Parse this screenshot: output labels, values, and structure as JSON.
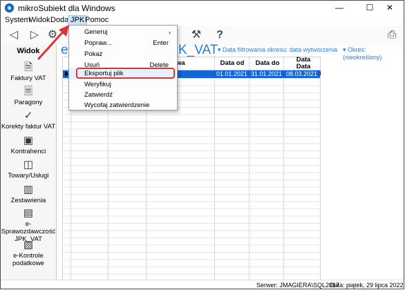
{
  "window": {
    "title": "mikroSubiekt dla Windows",
    "minimize_glyph": "—",
    "maximize_glyph": "☐",
    "close_glyph": "✕"
  },
  "menubar": {
    "items": [
      "System",
      "Widok",
      "Dodaj",
      "JPK",
      "Pomoc"
    ]
  },
  "toolbar": {
    "icons": [
      "back-arrow-icon",
      "forward-arrow-icon",
      "settings-icon",
      "tools-icon",
      "help-icon",
      "printer-icon"
    ]
  },
  "sidebar": {
    "title": "Widok",
    "items": [
      {
        "label": "Faktury VAT",
        "icon": "invoice-icon"
      },
      {
        "label": "Paragony",
        "icon": "receipt-icon"
      },
      {
        "label": "Korekty faktur VAT",
        "icon": "correction-icon"
      },
      {
        "label": "Kontrahenci",
        "icon": "contractors-icon"
      },
      {
        "label": "Towary/Usługi",
        "icon": "goods-icon"
      },
      {
        "label": "Zestawienia",
        "icon": "reports-icon"
      },
      {
        "label": "e-Sprawozdawczość JPK_VAT",
        "icon": "jpk-report-icon"
      },
      {
        "label": "e-Kontrole podatkowe",
        "icon": "tax-control-icon"
      }
    ]
  },
  "content": {
    "heading_prefix": "e-",
    "heading_suffix": "K_VAT",
    "date_filter": "Data filtrowania okresu: data wytworzenia",
    "period_filter": "Okres: (nieokreślony)",
    "columns": {
      "name_fragment": "wa",
      "date_from": "Data od",
      "date_to": "Data do",
      "created": "Data wytworzeni"
    },
    "selected_row": {
      "date_from": "01.01.2021",
      "date_to": "31.01.2021",
      "created": "08.03.2021 13"
    }
  },
  "dropdown": {
    "items": [
      {
        "label": "Generuj",
        "shortcut": "",
        "submenu": true
      },
      {
        "label": "Popraw...",
        "shortcut": "Enter",
        "submenu": false
      },
      {
        "label": "Pokaż",
        "shortcut": "",
        "submenu": false
      },
      {
        "label": "Usuń",
        "shortcut": "Delete",
        "submenu": false
      },
      {
        "label": "Eksportuj plik",
        "shortcut": "",
        "submenu": false
      },
      {
        "label": "Weryfikuj",
        "shortcut": "",
        "submenu": false
      },
      {
        "label": "Zatwierdź",
        "shortcut": "",
        "submenu": false
      },
      {
        "label": "Wycofaj zatwierdzenie",
        "shortcut": "",
        "submenu": false
      }
    ],
    "submenu_glyph": "›"
  },
  "statusbar": {
    "server": "Serwer: JMAGIERA\\SQL2017",
    "date": "Data: piątek, 29 lipca 2022"
  },
  "colors": {
    "accent": "#1f7dd8",
    "selection": "#1066d6",
    "annotation": "#d93333"
  }
}
